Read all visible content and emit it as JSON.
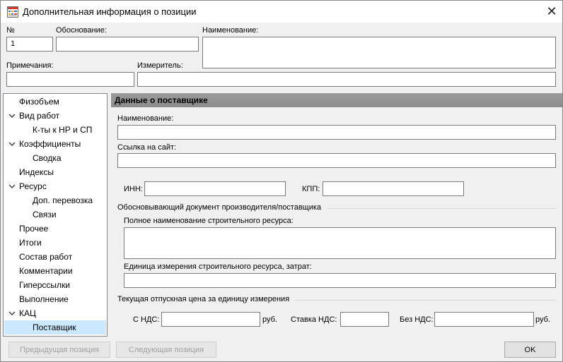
{
  "window": {
    "title": "Дополнительная информация о позиции",
    "close_glyph": "✕",
    "icon": "table-grid-icon"
  },
  "top_fields": {
    "number_label": "№",
    "number_value": "1",
    "justification_label": "Обоснование:",
    "justification_value": "",
    "name_label": "Наименование:",
    "name_value": "",
    "notes_label": "Примечания:",
    "notes_value": "",
    "unit_label": "Измеритель:",
    "unit_value": ""
  },
  "tree": {
    "items": [
      {
        "label": "Физобъем",
        "level": 0,
        "expanded": false
      },
      {
        "label": "Вид работ",
        "level": 0,
        "expanded": true
      },
      {
        "label": "К-ты к НР и СП",
        "level": 1,
        "expanded": false
      },
      {
        "label": "Коэффициенты",
        "level": 0,
        "expanded": true
      },
      {
        "label": "Сводка",
        "level": 1,
        "expanded": false
      },
      {
        "label": "Индексы",
        "level": 0,
        "expanded": false
      },
      {
        "label": "Ресурс",
        "level": 0,
        "expanded": true
      },
      {
        "label": "Доп. перевозка",
        "level": 1,
        "expanded": false
      },
      {
        "label": "Связи",
        "level": 1,
        "expanded": false
      },
      {
        "label": "Прочее",
        "level": 0,
        "expanded": false
      },
      {
        "label": "Итоги",
        "level": 0,
        "expanded": false
      },
      {
        "label": "Состав работ",
        "level": 0,
        "expanded": false
      },
      {
        "label": "Комментарии",
        "level": 0,
        "expanded": false
      },
      {
        "label": "Гиперссылки",
        "level": 0,
        "expanded": false
      },
      {
        "label": "Выполнение",
        "level": 0,
        "expanded": false
      },
      {
        "label": "КАЦ",
        "level": 0,
        "expanded": true
      },
      {
        "label": "Поставщик",
        "level": 1,
        "expanded": false,
        "selected": true
      }
    ]
  },
  "supplier": {
    "header": "Данные о поставщике",
    "name_label": "Наименование:",
    "name_value": "",
    "site_label": "Ссылка на сайт:",
    "site_value": "",
    "inn_label": "ИНН:",
    "inn_value": "",
    "kpp_label": "КПП:",
    "kpp_value": "",
    "doc_group_title": "Обосновывающий документ производителя/поставщика",
    "resource_name_label": "Полное наименование строительного ресурса:",
    "resource_name_value": "",
    "resource_unit_label": "Единица измерения строительного ресурса, затрат:",
    "resource_unit_value": "",
    "price_group_title": "Текущая отпускная цена за единицу измерения",
    "with_vat_label": "С НДС:",
    "with_vat_value": "",
    "rub1": "руб.",
    "vat_rate_label": "Ставка НДС:",
    "vat_rate_value": "",
    "without_vat_label": "Без НДС:",
    "without_vat_value": "",
    "rub2": "руб."
  },
  "footer": {
    "prev_label": "Предыдущая позиция",
    "next_label": "Следующая позиция",
    "ok_label": "OK"
  }
}
